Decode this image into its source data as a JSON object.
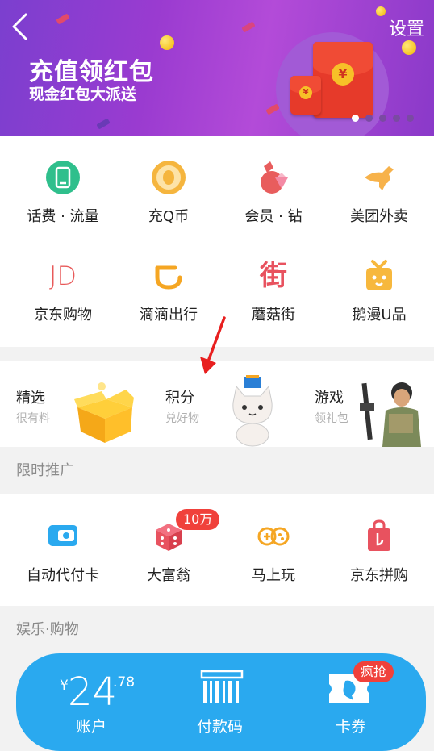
{
  "banner": {
    "title": "充值领红包",
    "subtitle": "现金红包大派送",
    "settings_label": "设置",
    "coin_symbol": "¥",
    "slide_count": 5,
    "active_slide": 0
  },
  "services": [
    {
      "label": "话费 · 流量",
      "icon": "phone-icon",
      "color": "#2fbf8c"
    },
    {
      "label": "充Q币",
      "icon": "qq-coin-icon",
      "color": "#f5b53e"
    },
    {
      "label": "会员 · 钻",
      "icon": "diamond-member-icon",
      "color": "#e85d5d"
    },
    {
      "label": "美团外卖",
      "icon": "kangaroo-icon",
      "color": "#f7b24a"
    },
    {
      "label": "京东购物",
      "icon": "jd-logo-icon",
      "color": "#e85a5a",
      "glyph": "JD"
    },
    {
      "label": "滴滴出行",
      "icon": "didi-icon",
      "color": "#f5a623"
    },
    {
      "label": "蘑菇街",
      "icon": "mogujie-icon",
      "color": "#e8525f",
      "glyph": "街"
    },
    {
      "label": "鹅漫U品",
      "icon": "gift-box-icon",
      "color": "#f7b83d"
    }
  ],
  "features": [
    {
      "title": "精选",
      "sub": "很有料",
      "icon": "gift-box-illustration"
    },
    {
      "title": "积分",
      "sub": "兑好物",
      "icon": "cat-mascot-illustration"
    },
    {
      "title": "游戏",
      "sub": "领礼包",
      "icon": "game-character-illustration"
    }
  ],
  "sections": {
    "limited": "限时推广",
    "entertainment": "娱乐·购物"
  },
  "promos": [
    {
      "label": "自动代付卡",
      "icon": "autopay-card-icon",
      "color": "#2aa9ef"
    },
    {
      "label": "大富翁",
      "icon": "dice-icon",
      "color": "#e8525f",
      "badge": "10万"
    },
    {
      "label": "马上玩",
      "icon": "gamepad-icon",
      "color": "#f5a623"
    },
    {
      "label": "京东拼购",
      "icon": "shopping-bag-icon",
      "color": "#e8525f"
    }
  ],
  "bottom_bar": {
    "currency": "¥",
    "balance_int": "24",
    "balance_dec": ".78",
    "account_label": "账户",
    "paycode_label": "付款码",
    "coupon_label": "卡券",
    "coupon_badge": "疯抢",
    "color": "#2aa9ef"
  }
}
